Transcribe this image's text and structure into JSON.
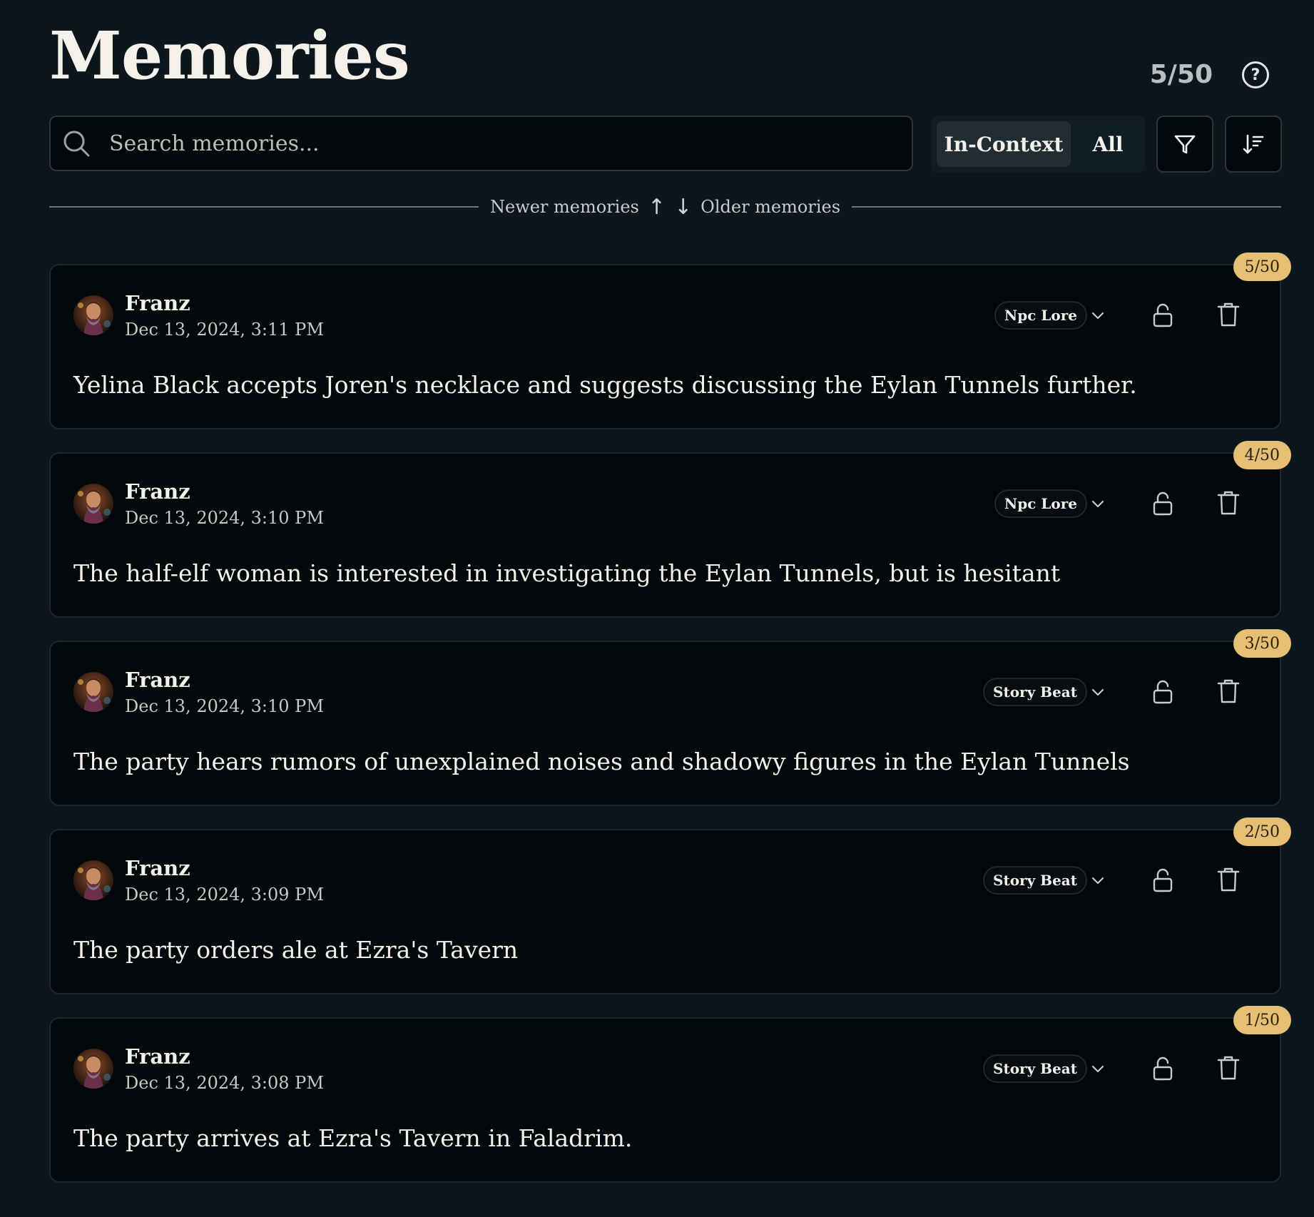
{
  "header": {
    "title": "Memories",
    "count": "5/50",
    "help_symbol": "?"
  },
  "search": {
    "placeholder": "Search memories...",
    "value": ""
  },
  "toggle": {
    "options": [
      "In-Context",
      "All"
    ],
    "selected": "In-Context"
  },
  "toolbar": {
    "filter_icon": "filter-icon",
    "sort_icon": "sort-descending-icon"
  },
  "divider": {
    "newer_label": "Newer memories",
    "newer_arrow": "↑",
    "older_arrow": "↓",
    "older_label": "Older memories"
  },
  "colors": {
    "background": "#0c161c",
    "card": "#03080b",
    "badge": "#e6be74"
  },
  "memories": [
    {
      "badge": "5/50",
      "author": "Franz",
      "date": "Dec 13, 2024, 3:11 PM",
      "tag": "Npc Lore",
      "text": "Yelina Black accepts Joren's necklace and suggests discussing the Eylan Tunnels further."
    },
    {
      "badge": "4/50",
      "author": "Franz",
      "date": "Dec 13, 2024, 3:10 PM",
      "tag": "Npc Lore",
      "text": "The half-elf woman is interested in investigating the Eylan Tunnels, but is hesitant"
    },
    {
      "badge": "3/50",
      "author": "Franz",
      "date": "Dec 13, 2024, 3:10 PM",
      "tag": "Story Beat",
      "text": "The party hears rumors of unexplained noises and shadowy figures in the Eylan Tunnels"
    },
    {
      "badge": "2/50",
      "author": "Franz",
      "date": "Dec 13, 2024, 3:09 PM",
      "tag": "Story Beat",
      "text": "The party orders ale at Ezra's Tavern"
    },
    {
      "badge": "1/50",
      "author": "Franz",
      "date": "Dec 13, 2024, 3:08 PM",
      "tag": "Story Beat",
      "text": "The party arrives at Ezra's Tavern in Faladrim."
    }
  ]
}
